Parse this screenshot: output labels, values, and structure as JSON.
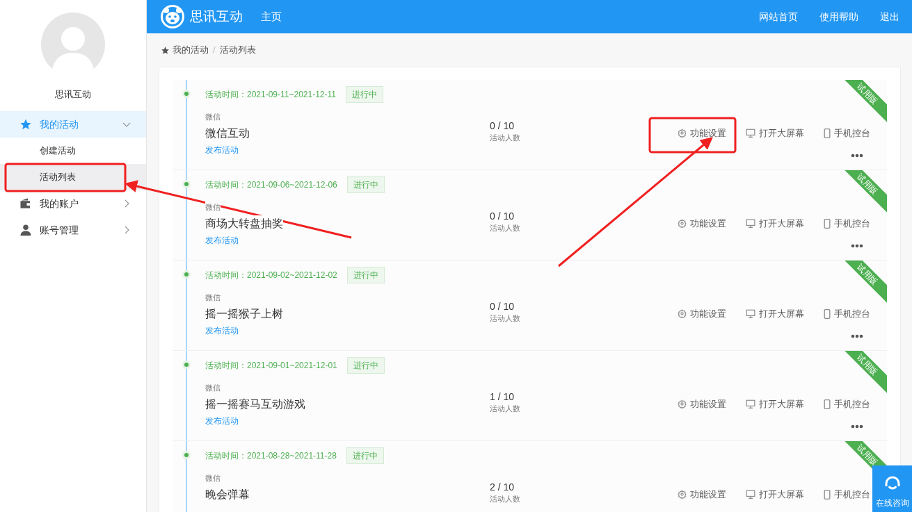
{
  "sidebar": {
    "user_name": "思讯互动",
    "menu": [
      {
        "label": "我的活动",
        "kind": "star",
        "expanded": true,
        "selected": true,
        "children": [
          {
            "label": "创建活动",
            "selected": false
          },
          {
            "label": "活动列表",
            "selected": true
          }
        ]
      },
      {
        "label": "我的账户",
        "kind": "wallet",
        "expanded": false,
        "selected": false
      },
      {
        "label": "账号管理",
        "kind": "user",
        "expanded": false,
        "selected": false
      }
    ]
  },
  "header": {
    "brand": "思讯互动",
    "nav": [
      "主页"
    ],
    "links": [
      "网站首页",
      "使用帮助",
      "退出"
    ]
  },
  "breadcrumb": {
    "items": [
      "我的活动",
      "活动列表"
    ],
    "separator": "/"
  },
  "activities": [
    {
      "time": "活动时间：2021-09-11~2021-12-11",
      "status": "进行中",
      "platform": "微信",
      "title": "微信互动",
      "publish": "发布活动",
      "count": "0 / 10",
      "count_label": "活动人数",
      "actions": [
        "功能设置",
        "打开大屏幕",
        "手机控台"
      ],
      "ribbon": "试用版"
    },
    {
      "time": "活动时间：2021-09-06~2021-12-06",
      "status": "进行中",
      "platform": "微信",
      "title": "商场大转盘抽奖",
      "publish": "发布活动",
      "count": "0 / 10",
      "count_label": "活动人数",
      "actions": [
        "功能设置",
        "打开大屏幕",
        "手机控台"
      ],
      "ribbon": "试用版"
    },
    {
      "time": "活动时间：2021-09-02~2021-12-02",
      "status": "进行中",
      "platform": "微信",
      "title": "摇一摇猴子上树",
      "publish": "发布活动",
      "count": "0 / 10",
      "count_label": "活动人数",
      "actions": [
        "功能设置",
        "打开大屏幕",
        "手机控台"
      ],
      "ribbon": "试用版"
    },
    {
      "time": "活动时间：2021-09-01~2021-12-01",
      "status": "进行中",
      "platform": "微信",
      "title": "摇一摇赛马互动游戏",
      "publish": "发布活动",
      "count": "1 / 10",
      "count_label": "活动人数",
      "actions": [
        "功能设置",
        "打开大屏幕",
        "手机控台"
      ],
      "ribbon": "试用版"
    },
    {
      "time": "活动时间：2021-08-28~2021-11-28",
      "status": "进行中",
      "platform": "微信",
      "title": "晚会弹幕",
      "count": "2 / 10",
      "count_label": "活动人数",
      "actions": [
        "功能设置",
        "打开大屏幕",
        "手机控台"
      ],
      "ribbon": "试用版"
    }
  ],
  "chat_button": {
    "label": "在线咨询"
  }
}
